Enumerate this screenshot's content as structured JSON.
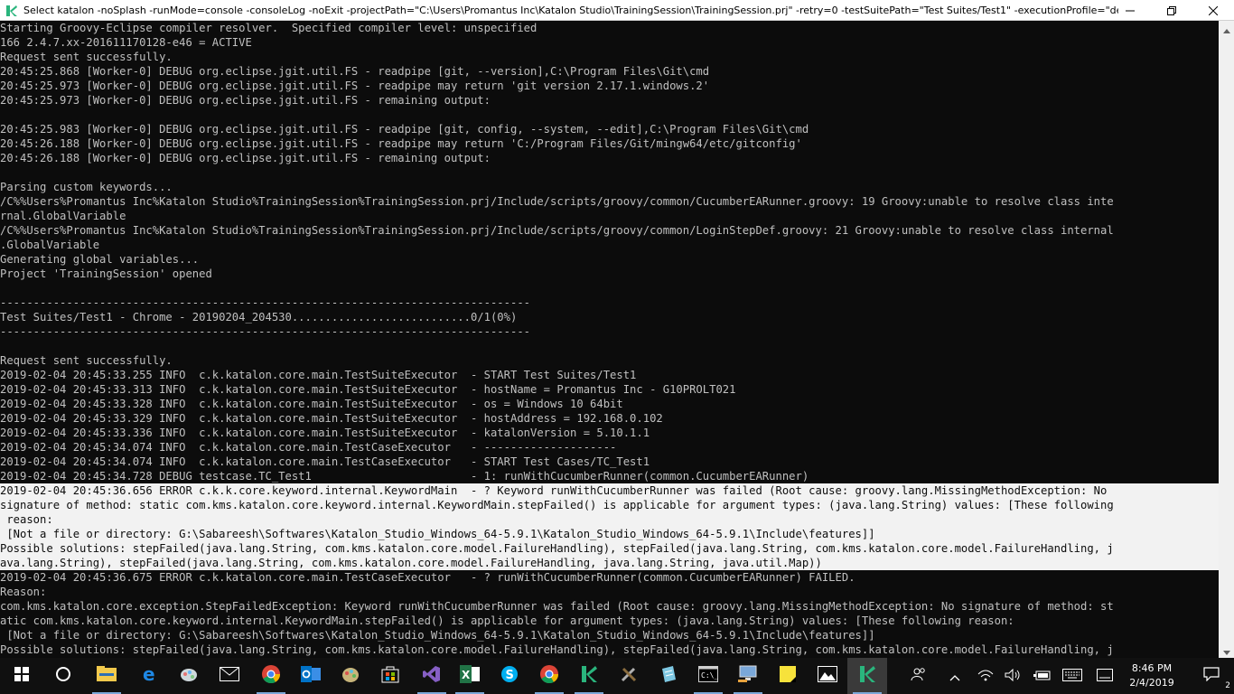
{
  "window": {
    "title": "Select katalon  -noSplash  -runMode=console -consoleLog -noExit -projectPath=\"C:\\Users\\Promantus Inc\\Katalon Studio\\TrainingSession\\TrainingSession.prj\" -retry=0 -testSuitePath=\"Test Suites/Test1\" -executionProfile=\"defa...",
    "app_icon": "katalon-icon",
    "controls": [
      "minimize-icon",
      "maximize-icon",
      "close-icon"
    ]
  },
  "console": {
    "background": "#0c0c0c",
    "text_color": "#c0c0c0",
    "selection_color": "#f2f2f2",
    "lines": [
      {
        "text": "Starting Groovy-Eclipse compiler resolver.  Specified compiler level: unspecified",
        "sel": false
      },
      {
        "text": "166 2.4.7.xx-201611170128-e46 = ACTIVE",
        "sel": false
      },
      {
        "text": "Request sent successfully.",
        "sel": false
      },
      {
        "text": "20:45:25.868 [Worker-0] DEBUG org.eclipse.jgit.util.FS - readpipe [git, --version],C:\\Program Files\\Git\\cmd",
        "sel": false
      },
      {
        "text": "20:45:25.973 [Worker-0] DEBUG org.eclipse.jgit.util.FS - readpipe may return 'git version 2.17.1.windows.2'",
        "sel": false
      },
      {
        "text": "20:45:25.973 [Worker-0] DEBUG org.eclipse.jgit.util.FS - remaining output:",
        "sel": false
      },
      {
        "text": "",
        "sel": false
      },
      {
        "text": "20:45:25.983 [Worker-0] DEBUG org.eclipse.jgit.util.FS - readpipe [git, config, --system, --edit],C:\\Program Files\\Git\\cmd",
        "sel": false
      },
      {
        "text": "20:45:26.188 [Worker-0] DEBUG org.eclipse.jgit.util.FS - readpipe may return 'C:/Program Files/Git/mingw64/etc/gitconfig'",
        "sel": false
      },
      {
        "text": "20:45:26.188 [Worker-0] DEBUG org.eclipse.jgit.util.FS - remaining output:",
        "sel": false
      },
      {
        "text": "",
        "sel": false
      },
      {
        "text": "Parsing custom keywords...",
        "sel": false
      },
      {
        "text": "/C%%Users%Promantus Inc%Katalon Studio%TrainingSession%TrainingSession.prj/Include/scripts/groovy/common/CucumberEARunner.groovy: 19 Groovy:unable to resolve class inte",
        "sel": false
      },
      {
        "text": "rnal.GlobalVariable",
        "sel": false
      },
      {
        "text": "/C%%Users%Promantus Inc%Katalon Studio%TrainingSession%TrainingSession.prj/Include/scripts/groovy/common/LoginStepDef.groovy: 21 Groovy:unable to resolve class internal",
        "sel": false
      },
      {
        "text": ".GlobalVariable",
        "sel": false
      },
      {
        "text": "Generating global variables...",
        "sel": false
      },
      {
        "text": "Project 'TrainingSession' opened",
        "sel": false
      },
      {
        "text": "",
        "sel": false
      },
      {
        "text": "--------------------------------------------------------------------------------",
        "sel": false
      },
      {
        "text": "Test Suites/Test1 - Chrome - 20190204_204530...........................0/1(0%)",
        "sel": false
      },
      {
        "text": "--------------------------------------------------------------------------------",
        "sel": false
      },
      {
        "text": "",
        "sel": false
      },
      {
        "text": "Request sent successfully.",
        "sel": false
      },
      {
        "text": "2019-02-04 20:45:33.255 INFO  c.k.katalon.core.main.TestSuiteExecutor  - START Test Suites/Test1",
        "sel": false
      },
      {
        "text": "2019-02-04 20:45:33.313 INFO  c.k.katalon.core.main.TestSuiteExecutor  - hostName = Promantus Inc - G10PROLT021",
        "sel": false
      },
      {
        "text": "2019-02-04 20:45:33.328 INFO  c.k.katalon.core.main.TestSuiteExecutor  - os = Windows 10 64bit",
        "sel": false
      },
      {
        "text": "2019-02-04 20:45:33.329 INFO  c.k.katalon.core.main.TestSuiteExecutor  - hostAddress = 192.168.0.102",
        "sel": false
      },
      {
        "text": "2019-02-04 20:45:33.336 INFO  c.k.katalon.core.main.TestSuiteExecutor  - katalonVersion = 5.10.1.1",
        "sel": false
      },
      {
        "text": "2019-02-04 20:45:34.074 INFO  c.k.katalon.core.main.TestCaseExecutor   - --------------------",
        "sel": false
      },
      {
        "text": "2019-02-04 20:45:34.074 INFO  c.k.katalon.core.main.TestCaseExecutor   - START Test Cases/TC_Test1",
        "sel": false
      },
      {
        "text": "2019-02-04 20:45:34.728 DEBUG testcase.TC_Test1                        - 1: runWithCucumberRunner(common.CucumberEARunner)",
        "sel": false
      },
      {
        "text": "2019-02-04 20:45:36.656 ERROR c.k.k.core.keyword.internal.KeywordMain  - ? Keyword runWithCucumberRunner was failed (Root cause: groovy.lang.MissingMethodException: No",
        "sel": true
      },
      {
        "text": "signature of method: static com.kms.katalon.core.keyword.internal.KeywordMain.stepFailed() is applicable for argument types: (java.lang.String) values: [These following",
        "sel": true
      },
      {
        "text": " reason:",
        "sel": true
      },
      {
        "text": " [Not a file or directory: G:\\Sabareesh\\Softwares\\Katalon_Studio_Windows_64-5.9.1\\Katalon_Studio_Windows_64-5.9.1\\Include\\features]]",
        "sel": true
      },
      {
        "text": "Possible solutions: stepFailed(java.lang.String, com.kms.katalon.core.model.FailureHandling), stepFailed(java.lang.String, com.kms.katalon.core.model.FailureHandling, j",
        "sel": true
      },
      {
        "text": "ava.lang.String), stepFailed(java.lang.String, com.kms.katalon.core.model.FailureHandling, java.lang.String, java.util.Map))",
        "sel": true
      },
      {
        "text": "2019-02-04 20:45:36.675 ERROR c.k.katalon.core.main.TestCaseExecutor   - ? runWithCucumberRunner(common.CucumberEARunner) FAILED.",
        "sel": false
      },
      {
        "text": "Reason:",
        "sel": false
      },
      {
        "text": "com.kms.katalon.core.exception.StepFailedException: Keyword runWithCucumberRunner was failed (Root cause: groovy.lang.MissingMethodException: No signature of method: st",
        "sel": false
      },
      {
        "text": "atic com.kms.katalon.core.keyword.internal.KeywordMain.stepFailed() is applicable for argument types: (java.lang.String) values: [These following reason:",
        "sel": false
      },
      {
        "text": " [Not a file or directory: G:\\Sabareesh\\Softwares\\Katalon_Studio_Windows_64-5.9.1\\Katalon_Studio_Windows_64-5.9.1\\Include\\features]]",
        "sel": false
      },
      {
        "text": "Possible solutions: stepFailed(java.lang.String, com.kms.katalon.core.model.FailureHandling), stepFailed(java.lang.String, com.kms.katalon.core.model.FailureHandling, j",
        "sel": false
      }
    ]
  },
  "scrollbar": {
    "up": "scroll-up-arrow-icon",
    "down": "scroll-down-arrow-icon"
  },
  "taskbar": {
    "apps": [
      {
        "name": "windows-start-icon",
        "color": "#ffffff"
      },
      {
        "name": "cortana-search-icon",
        "color": "#ffffff"
      },
      {
        "name": "file-explorer-icon",
        "color": "#f2c94c"
      },
      {
        "name": "edge-icon",
        "color": "#1e88e5"
      },
      {
        "name": "paint-brush-icon",
        "color": "#e57373"
      },
      {
        "name": "mail-icon",
        "color": "#ffffff"
      },
      {
        "name": "chrome-icon",
        "color": "#4caf50"
      },
      {
        "name": "outlook-icon",
        "color": "#0072c6"
      },
      {
        "name": "paint-palette-icon",
        "color": "#c8b57a"
      },
      {
        "name": "store-icon",
        "color": "#ffffff"
      },
      {
        "name": "visual-studio-icon",
        "color": "#865fc5"
      },
      {
        "name": "excel-icon",
        "color": "#217346"
      },
      {
        "name": "skype-icon",
        "color": "#00aff0"
      },
      {
        "name": "chrome-icon",
        "color": "#4caf50"
      },
      {
        "name": "katalon-icon",
        "color": "#2ab57d"
      },
      {
        "name": "tools-icon",
        "color": "#b0b0b0"
      },
      {
        "name": "document-icon",
        "color": "#7ec8e3"
      },
      {
        "name": "cmd-icon",
        "color": "#cfcfcf"
      },
      {
        "name": "network-computer-icon",
        "color": "#7aa7d8"
      },
      {
        "name": "sticky-notes-icon",
        "color": "#f7e23b"
      },
      {
        "name": "photos-icon",
        "color": "#ffffff"
      },
      {
        "name": "katalon-console-icon",
        "color": "#2ab57d"
      }
    ],
    "tray": [
      "people-icon",
      "chevron-up-icon",
      "wifi-icon",
      "volume-icon",
      "battery-icon",
      "keyboard-icon",
      "ime-icon"
    ],
    "clock": {
      "time": "8:46 PM",
      "date": "2/4/2019"
    },
    "notifications": {
      "count": "2",
      "icon": "notification-center-icon"
    }
  }
}
